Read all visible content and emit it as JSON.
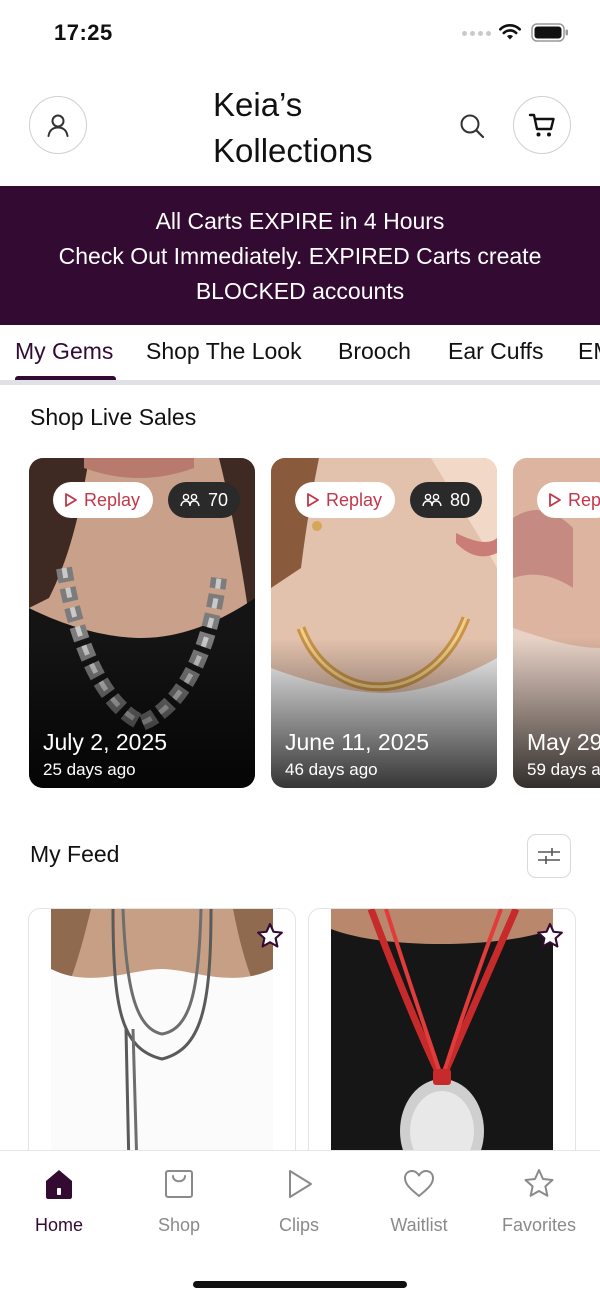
{
  "status_bar": {
    "time": "17:25"
  },
  "header": {
    "title_line1": "Keia’s",
    "title_line2": "Kollections",
    "avatar_icon": "user-icon",
    "search_icon": "search-icon",
    "cart_icon": "cart-icon"
  },
  "banner": {
    "line1": "All Carts EXPIRE in 4 Hours",
    "line2": "Check Out Immediately. EXPIRED Carts create",
    "line3": "BLOCKED accounts",
    "background": "#330b32"
  },
  "tabs": [
    {
      "label": "My Gems",
      "active": true
    },
    {
      "label": "Shop The Look"
    },
    {
      "label": "Brooch"
    },
    {
      "label": "Ear Cuffs"
    },
    {
      "label": "EM"
    }
  ],
  "live_sales": {
    "title": "Shop Live Sales",
    "cards": [
      {
        "replay": "Replay",
        "viewers": "70",
        "date": "July 2, 2025",
        "ago": "25 days ago"
      },
      {
        "replay": "Replay",
        "viewers": "80",
        "date": "June 11, 2025",
        "ago": "46 days ago"
      },
      {
        "replay": "Rep",
        "date": "May 29",
        "ago": "59 days a"
      }
    ]
  },
  "feed": {
    "title": "My Feed",
    "filter_icon": "sliders-icon",
    "favorite_icon": "star-icon"
  },
  "bottom_nav": [
    {
      "label": "Home",
      "icon": "home-icon",
      "active": true
    },
    {
      "label": "Shop",
      "icon": "shopping-bag-icon"
    },
    {
      "label": "Clips",
      "icon": "play-icon"
    },
    {
      "label": "Waitlist",
      "icon": "heart-icon"
    },
    {
      "label": "Favorites",
      "icon": "star-icon"
    }
  ],
  "colors": {
    "brand": "#330b32",
    "replay_text": "#c2374a",
    "inactive_nav": "#8a8a8a"
  }
}
